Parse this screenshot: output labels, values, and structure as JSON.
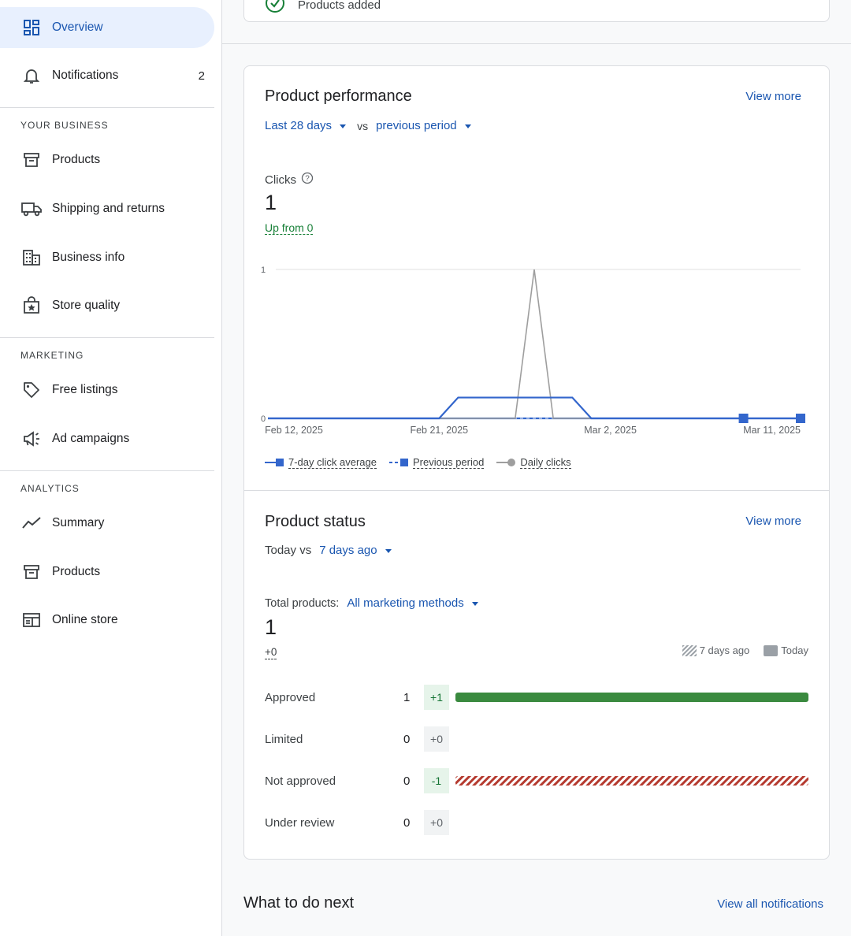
{
  "sidebar": {
    "overview": "Overview",
    "notifications": "Notifications",
    "notifications_count": "2",
    "section_business": "YOUR BUSINESS",
    "products": "Products",
    "shipping": "Shipping and returns",
    "business_info": "Business info",
    "store_quality": "Store quality",
    "section_marketing": "MARKETING",
    "free_listings": "Free listings",
    "ad_campaigns": "Ad campaigns",
    "section_analytics": "ANALYTICS",
    "summary": "Summary",
    "analytics_products": "Products",
    "online_store": "Online store"
  },
  "top_card": {
    "text": "Products added"
  },
  "performance": {
    "title": "Product performance",
    "view_more": "View more",
    "range": "Last 28 days",
    "vs": "vs",
    "compare": "previous period",
    "metric_label": "Clicks",
    "metric_value": "1",
    "metric_change": "Up from 0",
    "legend_avg": "7-day click average",
    "legend_prev": "Previous period",
    "legend_daily": "Daily clicks"
  },
  "chart_data": {
    "type": "line",
    "x_tick_labels": [
      "Feb 12, 2025",
      "Feb 21, 2025",
      "Mar 2, 2025",
      "Mar 11, 2025"
    ],
    "y_tick_labels": [
      "0",
      "1"
    ],
    "ylim": [
      0,
      1
    ],
    "x": [
      "Feb 12",
      "Feb 13",
      "Feb 14",
      "Feb 15",
      "Feb 16",
      "Feb 17",
      "Feb 18",
      "Feb 19",
      "Feb 20",
      "Feb 21",
      "Feb 22",
      "Feb 23",
      "Feb 24",
      "Feb 25",
      "Feb 26",
      "Feb 27",
      "Feb 28",
      "Mar 1",
      "Mar 2",
      "Mar 3",
      "Mar 4",
      "Mar 5",
      "Mar 6",
      "Mar 7",
      "Mar 8",
      "Mar 9",
      "Mar 10",
      "Mar 11",
      "Mar 12"
    ],
    "series": [
      {
        "name": "7-day click average",
        "color": "#3366cc",
        "values": [
          0,
          0,
          0,
          0,
          0,
          0,
          0,
          0,
          0,
          0,
          0.14,
          0.14,
          0.14,
          0.14,
          0.14,
          0.14,
          0.14,
          0,
          0,
          0,
          0,
          0,
          0,
          0,
          0,
          0,
          0,
          0,
          0
        ]
      },
      {
        "name": "Previous period",
        "color": "#3366cc",
        "values": [
          0,
          0,
          0,
          0,
          0,
          0,
          0,
          0,
          0,
          0,
          0,
          0,
          0,
          0,
          0,
          0,
          0,
          0,
          0,
          0,
          0,
          0,
          0,
          0,
          0,
          0,
          0,
          0,
          0
        ]
      },
      {
        "name": "Daily clicks",
        "color": "#9e9e9e",
        "values": [
          0,
          0,
          0,
          0,
          0,
          0,
          0,
          0,
          0,
          0,
          0,
          0,
          0,
          0,
          1,
          0,
          0,
          0,
          0,
          0,
          0,
          0,
          0,
          0,
          0,
          0,
          0,
          0,
          0
        ]
      }
    ],
    "grid": true,
    "legend": "bottom-left"
  },
  "status": {
    "title": "Product status",
    "view_more": "View more",
    "today_vs": "Today vs",
    "compare": "7 days ago",
    "total_label": "Total products:",
    "total_filter": "All marketing methods",
    "total_value": "1",
    "total_change": "+0",
    "legend_past": "7 days ago",
    "legend_today": "Today",
    "rows": [
      {
        "label": "Approved",
        "count": "1",
        "delta": "+1",
        "today_fraction": 1,
        "past_fraction": 0
      },
      {
        "label": "Limited",
        "count": "0",
        "delta": "+0",
        "today_fraction": 0,
        "past_fraction": 0
      },
      {
        "label": "Not approved",
        "count": "0",
        "delta": "-1",
        "today_fraction": 0,
        "past_fraction": 1
      },
      {
        "label": "Under review",
        "count": "0",
        "delta": "+0",
        "today_fraction": 0,
        "past_fraction": 0
      }
    ]
  },
  "next": {
    "title": "What to do next",
    "view_all": "View all notifications"
  },
  "colors": {
    "accent": "#1a56b0",
    "approved": "#3a8a3f",
    "not_approved": "#b53a2f",
    "active_bg": "#e8f0fe"
  }
}
